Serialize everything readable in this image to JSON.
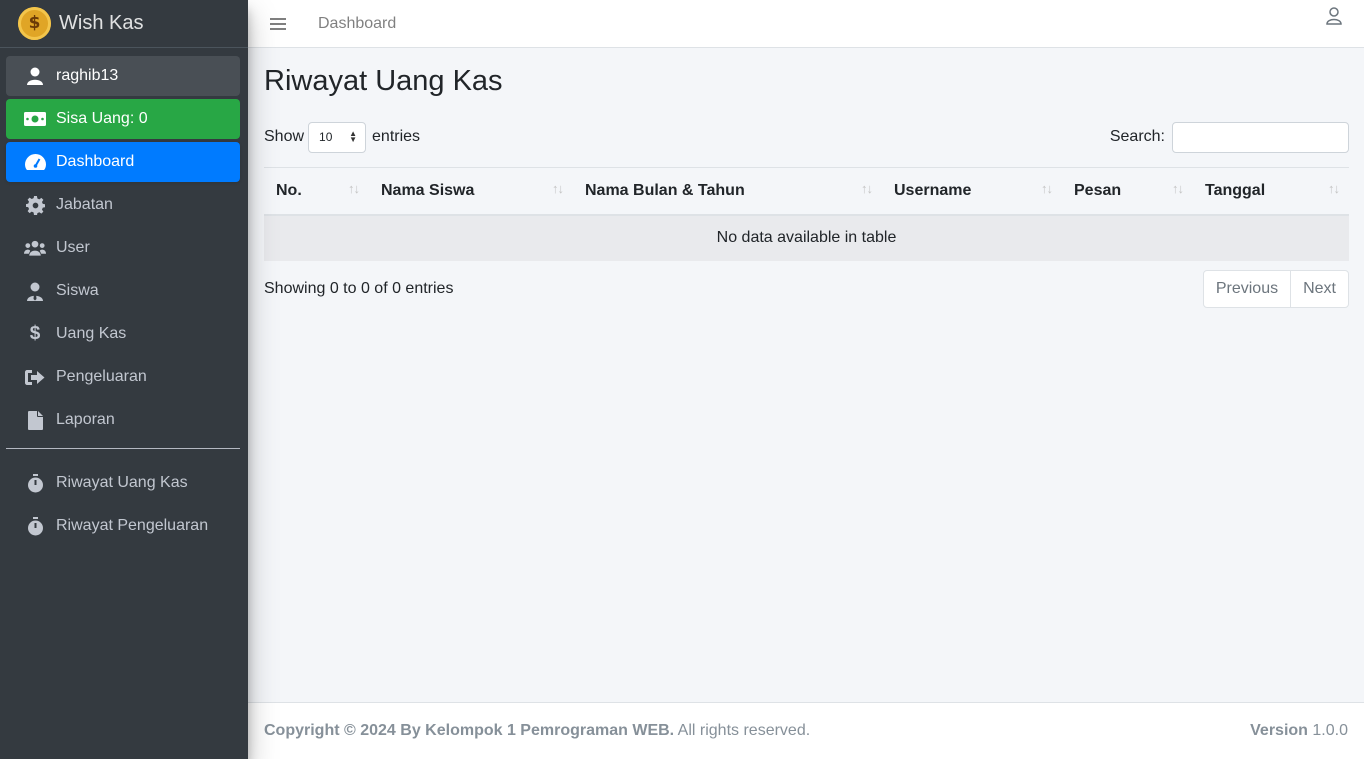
{
  "brand": {
    "name": "Wish Kas"
  },
  "sidebar": {
    "user": {
      "label": "raghib13"
    },
    "balance": {
      "label": "Sisa Uang: 0"
    },
    "items": [
      {
        "label": "Dashboard",
        "icon": "tachometer-icon"
      },
      {
        "label": "Jabatan",
        "icon": "gear-icon"
      },
      {
        "label": "User",
        "icon": "users-icon"
      },
      {
        "label": "Siswa",
        "icon": "user-tie-icon"
      },
      {
        "label": "Uang Kas",
        "icon": "dollar-icon"
      },
      {
        "label": "Pengeluaran",
        "icon": "sign-out-icon"
      },
      {
        "label": "Laporan",
        "icon": "file-icon"
      }
    ],
    "history": [
      {
        "label": "Riwayat Uang Kas",
        "icon": "stopwatch-icon"
      },
      {
        "label": "Riwayat Pengeluaran",
        "icon": "stopwatch-icon"
      }
    ]
  },
  "topbar": {
    "link": "Dashboard"
  },
  "main": {
    "title": "Riwayat Uang Kas",
    "show_label": "Show",
    "entries_value": "10",
    "entries_label": "entries",
    "search_label": "Search:",
    "search_value": "",
    "columns": [
      "No.",
      "Nama Siswa",
      "Nama Bulan & Tahun",
      "Username",
      "Pesan",
      "Tanggal"
    ],
    "empty_message": "No data available in table",
    "info": "Showing 0 to 0 of 0 entries",
    "previous": "Previous",
    "next": "Next"
  },
  "footer": {
    "copyright": "Copyright © 2024 By Kelompok 1 Pemrograman WEB.",
    "rights": "All rights reserved.",
    "version_label": "Version",
    "version": "1.0.0"
  },
  "colors": {
    "sidebar": "#343a40",
    "active": "#007bff",
    "balance": "#28a745"
  }
}
